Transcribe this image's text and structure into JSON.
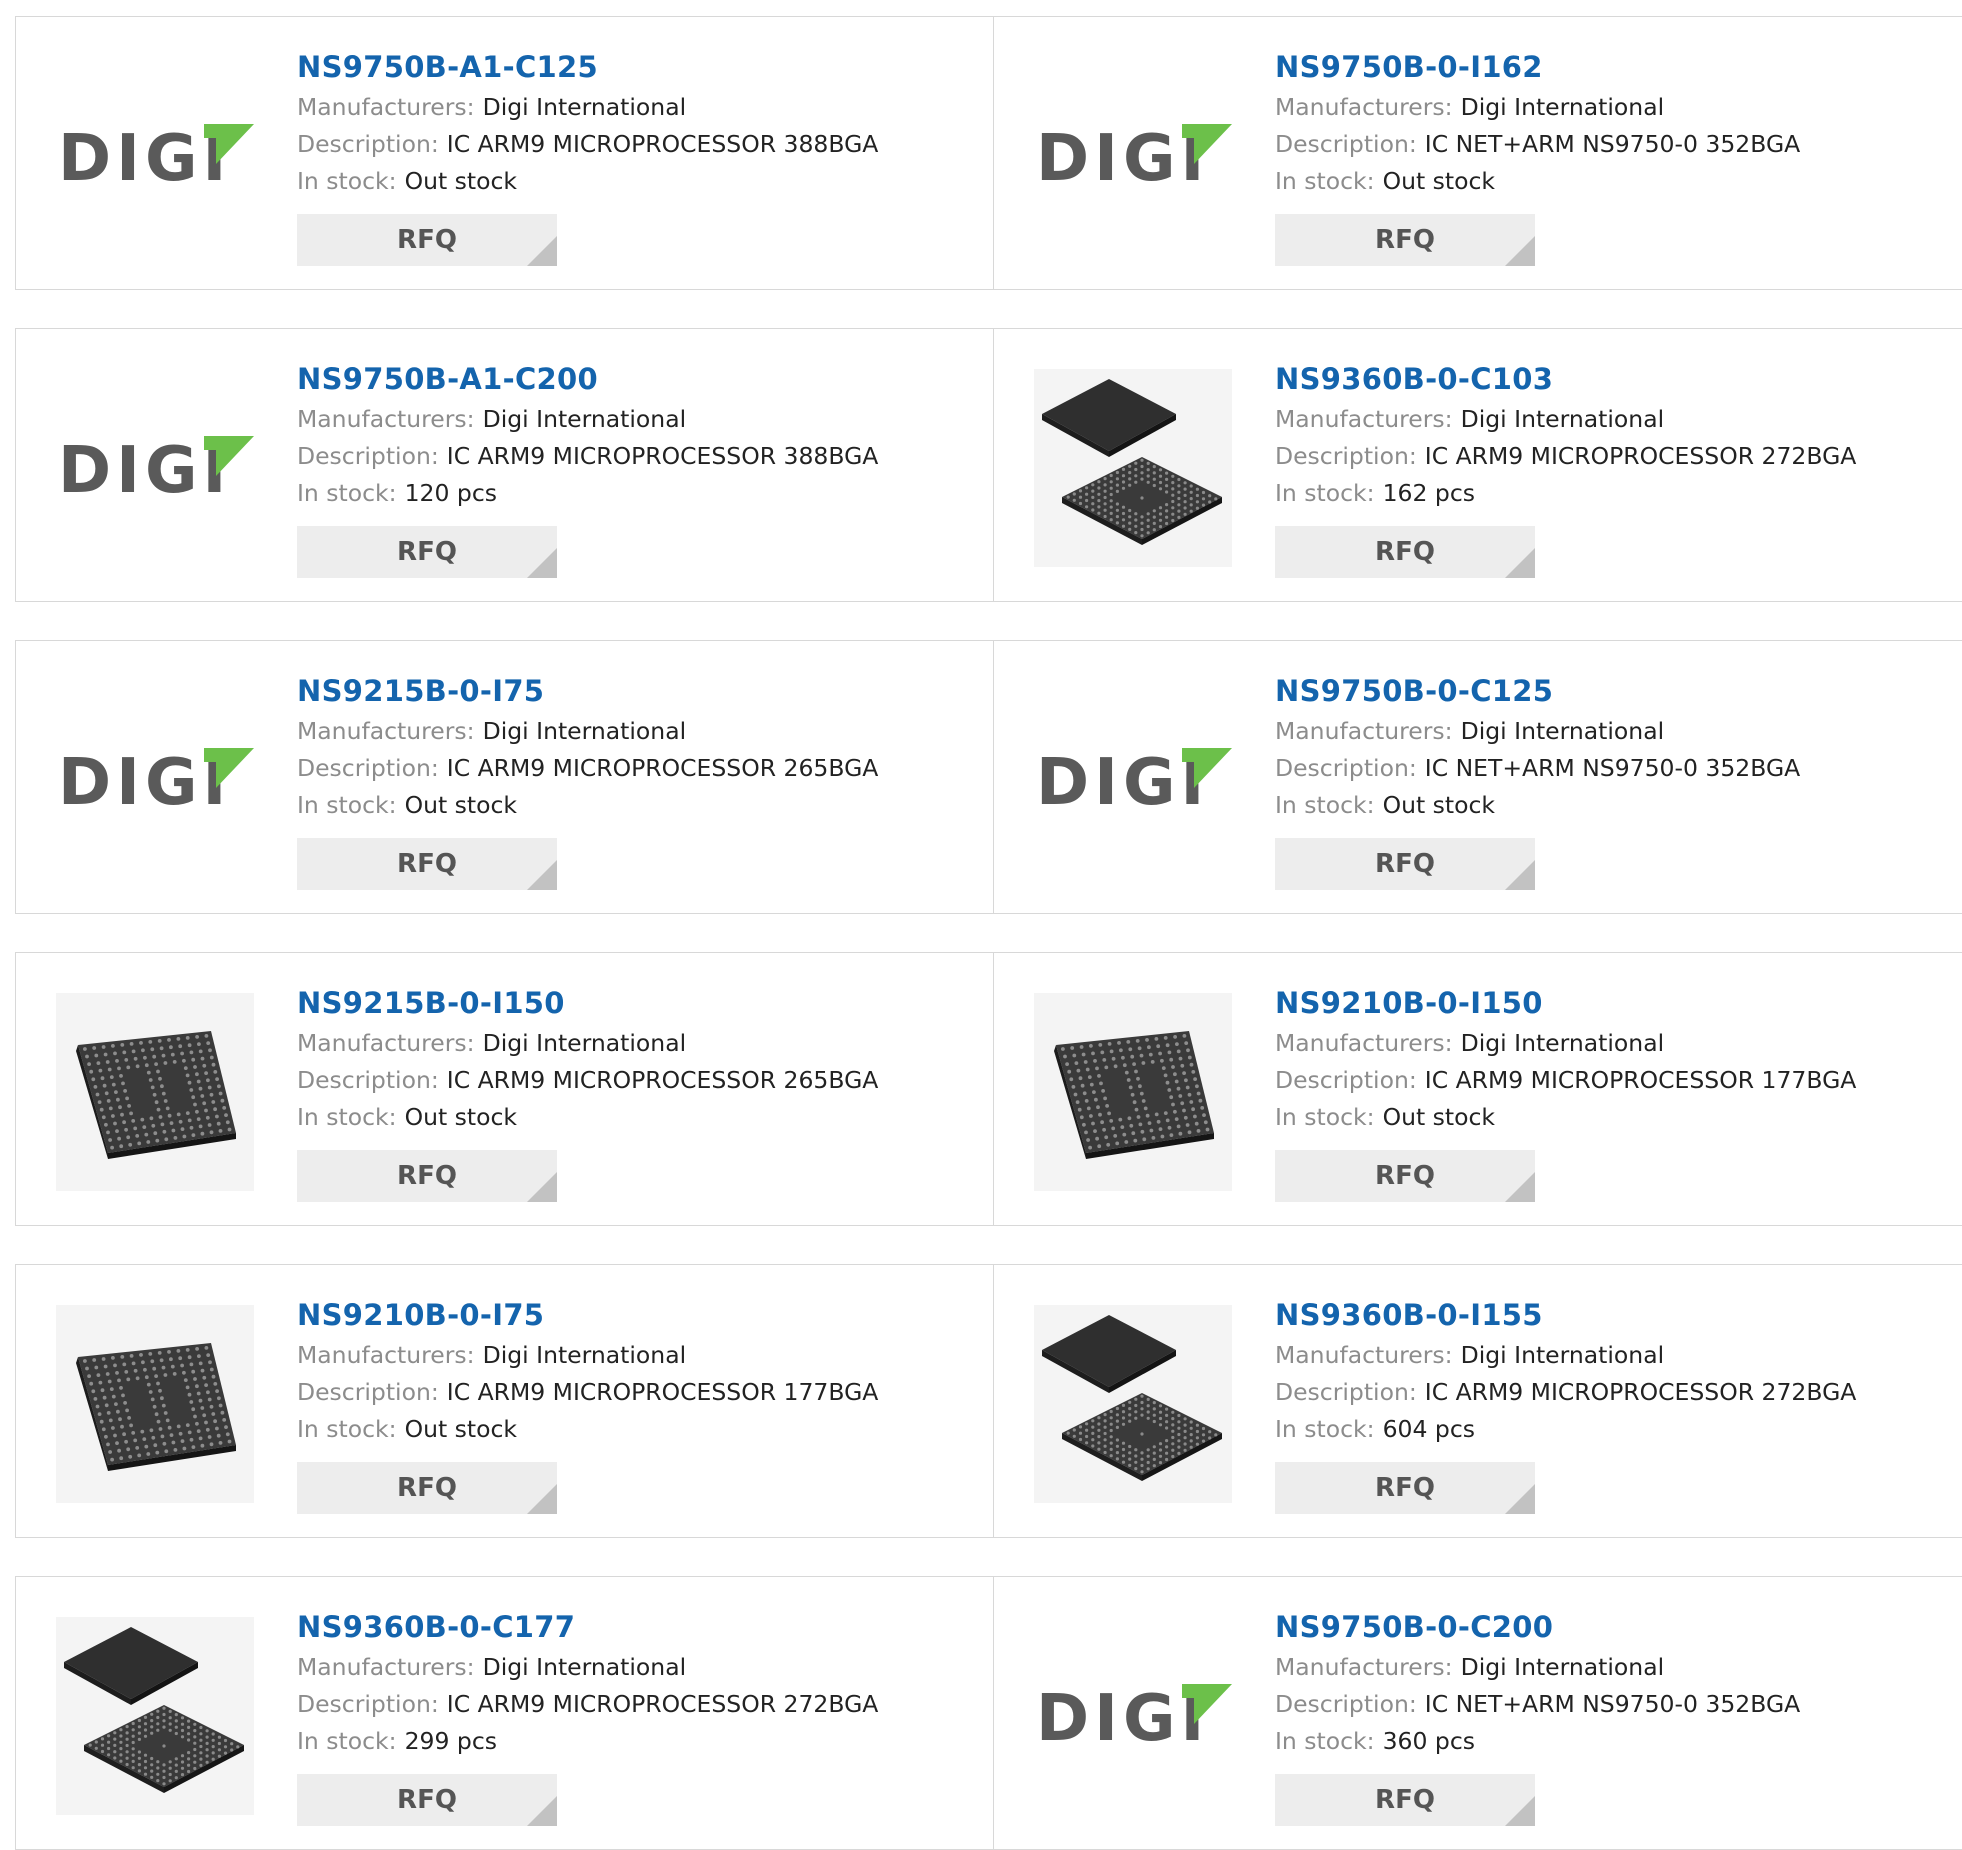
{
  "labels": {
    "manufacturers": "Manufacturers:",
    "description": "Description:",
    "stock": "In stock:",
    "rfq": "RFQ"
  },
  "logo_text": "DIGI",
  "colors": {
    "link": "#1464ad",
    "logo_gray": "#5a5a5a",
    "logo_green": "#6cc04a",
    "rfq_bg": "#ededed"
  },
  "products": [
    {
      "name": "NS9750B-A1-C125",
      "manufacturer": "Digi International",
      "description": "IC ARM9 MICROPROCESSOR 388BGA",
      "stock": "Out stock",
      "image": "digi-logo"
    },
    {
      "name": "NS9750B-0-I162",
      "manufacturer": "Digi International",
      "description": "IC NET+ARM NS9750-0 352BGA",
      "stock": "Out stock",
      "image": "digi-logo"
    },
    {
      "name": "NS9750B-A1-C200",
      "manufacturer": "Digi International",
      "description": "IC ARM9 MICROPROCESSOR 388BGA",
      "stock": "120 pcs",
      "image": "digi-logo"
    },
    {
      "name": "NS9360B-0-C103",
      "manufacturer": "Digi International",
      "description": "IC ARM9 MICROPROCESSOR 272BGA",
      "stock": "162 pcs",
      "image": "bga-chip-pair"
    },
    {
      "name": "NS9215B-0-I75",
      "manufacturer": "Digi International",
      "description": "IC ARM9 MICROPROCESSOR 265BGA",
      "stock": "Out stock",
      "image": "digi-logo"
    },
    {
      "name": "NS9750B-0-C125",
      "manufacturer": "Digi International",
      "description": "IC NET+ARM NS9750-0 352BGA",
      "stock": "Out stock",
      "image": "digi-logo"
    },
    {
      "name": "NS9215B-0-I150",
      "manufacturer": "Digi International",
      "description": "IC ARM9 MICROPROCESSOR 265BGA",
      "stock": "Out stock",
      "image": "bga-chip"
    },
    {
      "name": "NS9210B-0-I150",
      "manufacturer": "Digi International",
      "description": "IC ARM9 MICROPROCESSOR 177BGA",
      "stock": "Out stock",
      "image": "bga-chip"
    },
    {
      "name": "NS9210B-0-I75",
      "manufacturer": "Digi International",
      "description": "IC ARM9 MICROPROCESSOR 177BGA",
      "stock": "Out stock",
      "image": "bga-chip"
    },
    {
      "name": "NS9360B-0-I155",
      "manufacturer": "Digi International",
      "description": "IC ARM9 MICROPROCESSOR 272BGA",
      "stock": "604 pcs",
      "image": "bga-chip-pair"
    },
    {
      "name": "NS9360B-0-C177",
      "manufacturer": "Digi International",
      "description": "IC ARM9 MICROPROCESSOR 272BGA",
      "stock": "299 pcs",
      "image": "bga-chip-pair"
    },
    {
      "name": "NS9750B-0-C200",
      "manufacturer": "Digi International",
      "description": "IC NET+ARM NS9750-0 352BGA",
      "stock": "360 pcs",
      "image": "digi-logo"
    }
  ]
}
